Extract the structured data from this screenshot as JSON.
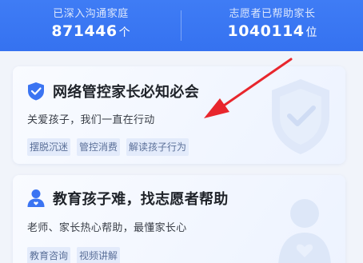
{
  "stats": {
    "left": {
      "label": "已深入沟通家庭",
      "value": "871446",
      "unit": "个"
    },
    "right": {
      "label": "志愿者已帮助家长",
      "value": "1040114",
      "unit": "位"
    }
  },
  "cards": [
    {
      "icon": "shield-check-icon",
      "title": "网络管控家长必知必会",
      "subtitle": "关爱孩子，我们一直在行动",
      "tags": [
        "摆脱沉迷",
        "管控消费",
        "解读孩子行为"
      ]
    },
    {
      "icon": "person-heart-icon",
      "title": "教育孩子难，找志愿者帮助",
      "subtitle": "老师、家长热心帮助，最懂家长心",
      "tags": [
        "教育咨询",
        "视频讲解"
      ]
    }
  ],
  "colors": {
    "header_blue": "#3572f0",
    "accent_blue": "#3b74f2",
    "tag_bg": "#e3ebfb",
    "tag_text": "#5a6f98",
    "annotation_red": "#e8262d"
  }
}
